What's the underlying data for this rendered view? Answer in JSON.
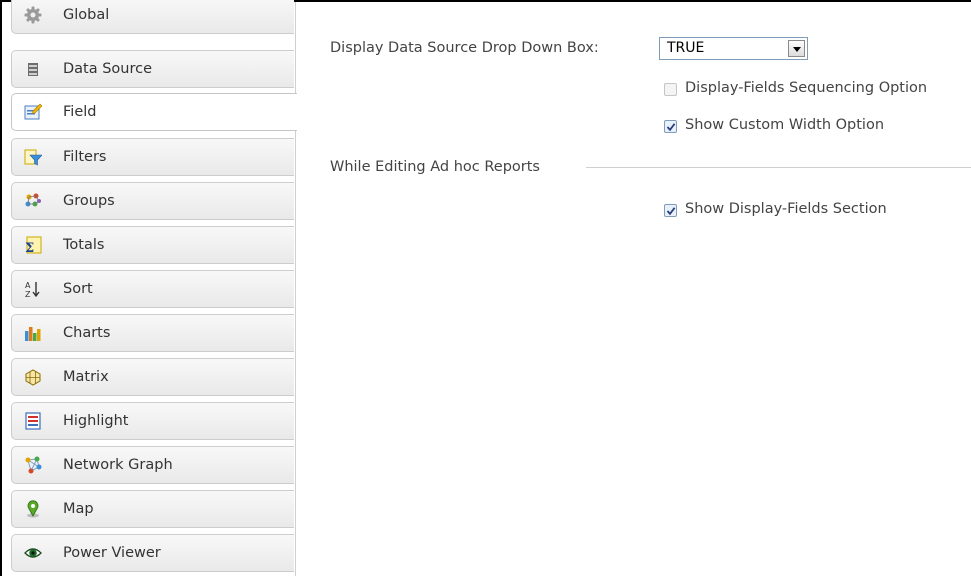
{
  "sidebar": {
    "items": [
      {
        "label": "Global",
        "icon": "gear-icon"
      },
      {
        "label": "Data Source",
        "icon": "database-icon"
      },
      {
        "label": "Field",
        "icon": "field-edit-icon",
        "active": true
      },
      {
        "label": "Filters",
        "icon": "filter-icon"
      },
      {
        "label": "Groups",
        "icon": "groups-icon"
      },
      {
        "label": "Totals",
        "icon": "sigma-icon"
      },
      {
        "label": "Sort",
        "icon": "sort-az-icon"
      },
      {
        "label": "Charts",
        "icon": "bar-chart-icon"
      },
      {
        "label": "Matrix",
        "icon": "matrix-icon"
      },
      {
        "label": "Highlight",
        "icon": "highlight-icon"
      },
      {
        "label": "Network Graph",
        "icon": "network-graph-icon"
      },
      {
        "label": "Map",
        "icon": "map-pin-icon"
      },
      {
        "label": "Power Viewer",
        "icon": "eye-icon"
      }
    ]
  },
  "main": {
    "datasource_dropdown_label": "Display Data Source Drop Down Box:",
    "datasource_dropdown_value": "TRUE",
    "options": [
      {
        "label": "Display-Fields Sequencing Option",
        "checked": false,
        "disabled": true
      },
      {
        "label": "Show Custom Width Option",
        "checked": true,
        "disabled": false
      }
    ],
    "adhoc_section_title": "While Editing Ad hoc Reports",
    "adhoc_options": [
      {
        "label": "Show Display-Fields Section",
        "checked": true,
        "disabled": false
      }
    ]
  },
  "colors": {
    "tab_border": "#cdcdcd",
    "select_border": "#7f9db9",
    "check_mark": "#2a3f7a"
  }
}
